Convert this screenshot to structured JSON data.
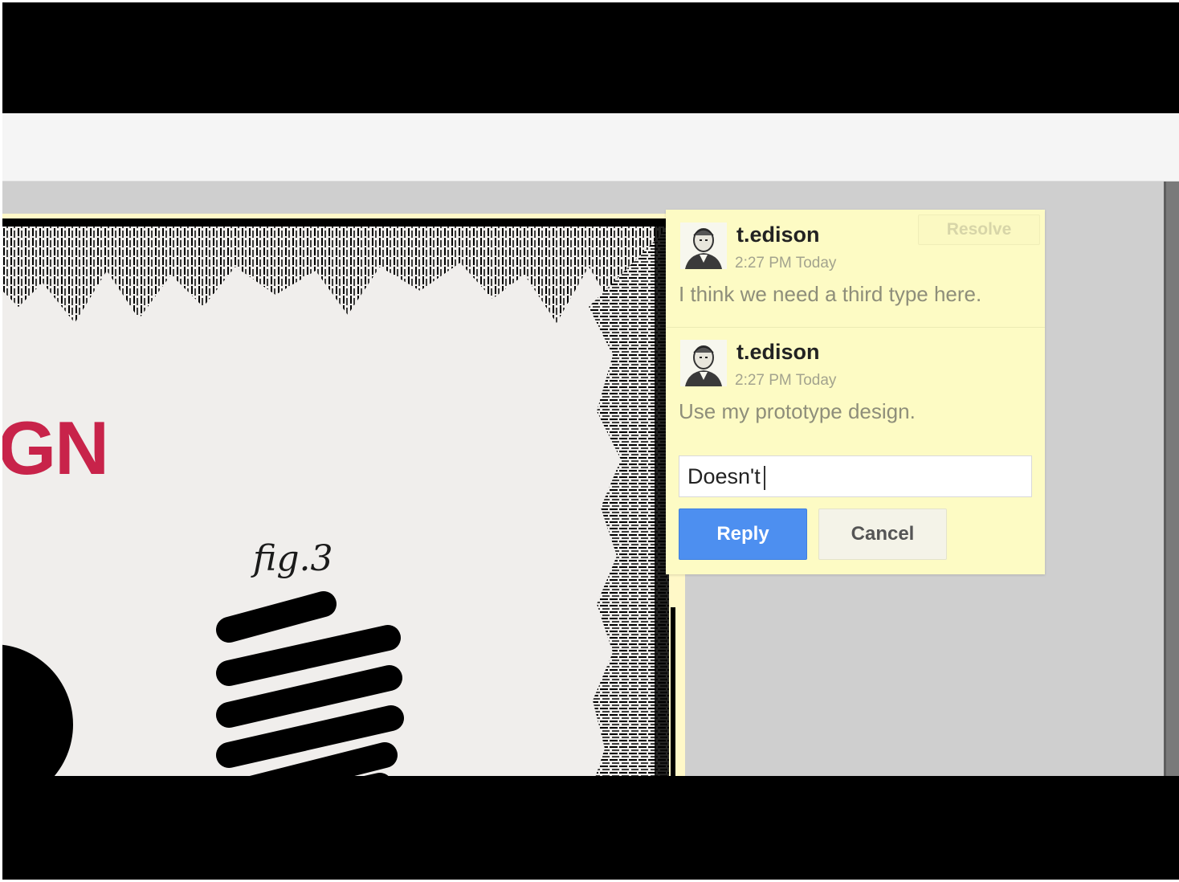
{
  "document": {
    "heading_fragment": "GN",
    "figure_caption": "fig.3"
  },
  "comments_panel": {
    "resolve_label": "Resolve",
    "comments": [
      {
        "author": "t.edison",
        "timestamp": "2:27 PM Today",
        "text": "I think we need a third type here."
      },
      {
        "author": "t.edison",
        "timestamp": "2:27 PM Today",
        "text": "Use my prototype design."
      }
    ],
    "reply_input_value": "Doesn't",
    "reply_label": "Reply",
    "cancel_label": "Cancel"
  },
  "colors": {
    "accent_blue": "#4d8ff0",
    "comment_bg": "#fdfbc4",
    "heading_red": "#c8234a"
  }
}
